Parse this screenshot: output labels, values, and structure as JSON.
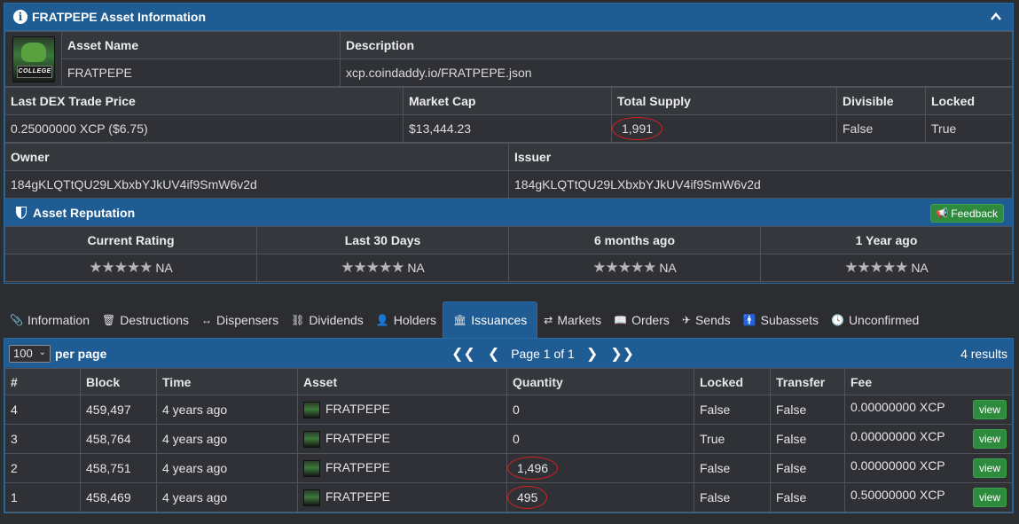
{
  "asset_panel": {
    "title": "FRATPEPE Asset Information",
    "logo_text": "COLLEGE",
    "asset_name_label": "Asset Name",
    "asset_name": "FRATPEPE",
    "description_label": "Description",
    "description": "xcp.coindaddy.io/FRATPEPE.json",
    "last_dex_label": "Last DEX Trade Price",
    "last_dex": "0.25000000 XCP ($6.75)",
    "market_cap_label": "Market Cap",
    "market_cap": "$13,444.23",
    "total_supply_label": "Total Supply",
    "total_supply": "1,991",
    "divisible_label": "Divisible",
    "divisible": "False",
    "locked_label": "Locked",
    "locked": "True",
    "owner_label": "Owner",
    "owner": "184gKLQTtQU29LXbxbYJkUV4if9SmW6v2d",
    "issuer_label": "Issuer",
    "issuer": "184gKLQTtQU29LXbxbYJkUV4if9SmW6v2d"
  },
  "reputation": {
    "title": "Asset Reputation",
    "feedback_label": "Feedback",
    "columns": [
      {
        "label": "Current Rating",
        "value": "NA"
      },
      {
        "label": "Last 30 Days",
        "value": "NA"
      },
      {
        "label": "6 months ago",
        "value": "NA"
      },
      {
        "label": "1 Year ago",
        "value": "NA"
      }
    ]
  },
  "tabs": [
    {
      "label": "Information",
      "icon": "paperclip-icon"
    },
    {
      "label": "Destructions",
      "icon": "trash-icon"
    },
    {
      "label": "Dispensers",
      "icon": "arrows-h-icon"
    },
    {
      "label": "Dividends",
      "icon": "sitemap-icon"
    },
    {
      "label": "Holders",
      "icon": "user-icon"
    },
    {
      "label": "Issuances",
      "icon": "bank-icon",
      "active": true
    },
    {
      "label": "Markets",
      "icon": "exchange-icon"
    },
    {
      "label": "Orders",
      "icon": "book-icon"
    },
    {
      "label": "Sends",
      "icon": "paper-plane-icon"
    },
    {
      "label": "Subassets",
      "icon": "child-icon"
    },
    {
      "label": "Unconfirmed",
      "icon": "clock-icon"
    }
  ],
  "issuances": {
    "per_page_value": "100",
    "per_page_label": "per page",
    "page_label": "Page 1 of 1",
    "results": "4 results",
    "headers": [
      "#",
      "Block",
      "Time",
      "Asset",
      "Quantity",
      "Locked",
      "Transfer",
      "Fee"
    ],
    "view_label": "view",
    "rows": [
      {
        "n": "4",
        "block": "459,497",
        "time": "4 years ago",
        "asset": "FRATPEPE",
        "quantity": "0",
        "locked": "False",
        "transfer": "False",
        "fee": "0.00000000 XCP"
      },
      {
        "n": "3",
        "block": "458,764",
        "time": "4 years ago",
        "asset": "FRATPEPE",
        "quantity": "0",
        "locked": "True",
        "transfer": "False",
        "fee": "0.00000000 XCP"
      },
      {
        "n": "2",
        "block": "458,751",
        "time": "4 years ago",
        "asset": "FRATPEPE",
        "quantity": "1,496",
        "locked": "False",
        "transfer": "False",
        "fee": "0.00000000 XCP"
      },
      {
        "n": "1",
        "block": "458,469",
        "time": "4 years ago",
        "asset": "FRATPEPE",
        "quantity": "495",
        "locked": "False",
        "transfer": "False",
        "fee": "0.50000000 XCP"
      }
    ]
  },
  "colors": {
    "header_blue": "#1f5c94",
    "button_green": "#2e8b3e",
    "annotation_red": "#d62121"
  }
}
